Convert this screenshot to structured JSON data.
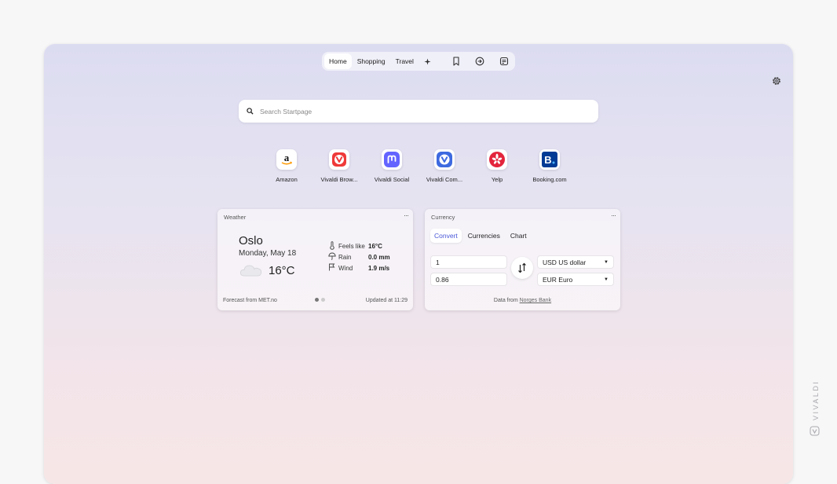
{
  "topnav": {
    "tabs": [
      {
        "label": "Home",
        "active": true
      },
      {
        "label": "Shopping",
        "active": false
      },
      {
        "label": "Travel",
        "active": false
      }
    ],
    "add_icon": "plus-icon",
    "icons": [
      "bookmark-icon",
      "history-icon",
      "notes-icon"
    ]
  },
  "settings_icon": "gear-icon",
  "search": {
    "placeholder": "Search Startpage",
    "value": ""
  },
  "speed_dials": [
    {
      "label": "Amazon",
      "icon": "amazon-logo"
    },
    {
      "label": "Vivaldi Brow...",
      "icon": "vivaldi-logo"
    },
    {
      "label": "Vivaldi Social",
      "icon": "mastodon-logo"
    },
    {
      "label": "Vivaldi Com...",
      "icon": "vivaldi-community-logo"
    },
    {
      "label": "Yelp",
      "icon": "yelp-logo"
    },
    {
      "label": "Booking.com",
      "icon": "booking-logo"
    }
  ],
  "weather": {
    "title": "Weather",
    "more": "···",
    "city": "Oslo",
    "date": "Monday, May 18",
    "temperature": "16°C",
    "condition_icon": "cloud-icon",
    "details": [
      {
        "icon": "thermometer-icon",
        "label": "Feels like",
        "value": "16°C"
      },
      {
        "icon": "umbrella-icon",
        "label": "Rain",
        "value": "0.0 mm"
      },
      {
        "icon": "flag-icon",
        "label": "Wind",
        "value": "1.9 m/s"
      }
    ],
    "source": "Forecast from MET.no",
    "updated": "Updated at 11:29",
    "page_dots": 2,
    "active_dot": 1
  },
  "currency": {
    "title": "Currency",
    "more": "···",
    "tabs": [
      {
        "label": "Convert",
        "active": true
      },
      {
        "label": "Currencies",
        "active": false
      },
      {
        "label": "Chart",
        "active": false
      }
    ],
    "amount_from": "1",
    "amount_to": "0.86",
    "currency_from": "USD US dollar",
    "currency_to": "EUR Euro",
    "swap_icon": "swap-arrows-icon",
    "footer_prefix": "Data from ",
    "footer_link": "Norges Bank"
  },
  "brand_watermark": "VIVALDI",
  "colors": {
    "accent": "#4a58d8",
    "vivaldi_red": "#ef3939",
    "mastodon_purple": "#6364ff",
    "yelp_red": "#e3253c",
    "booking_blue": "#003b95"
  }
}
